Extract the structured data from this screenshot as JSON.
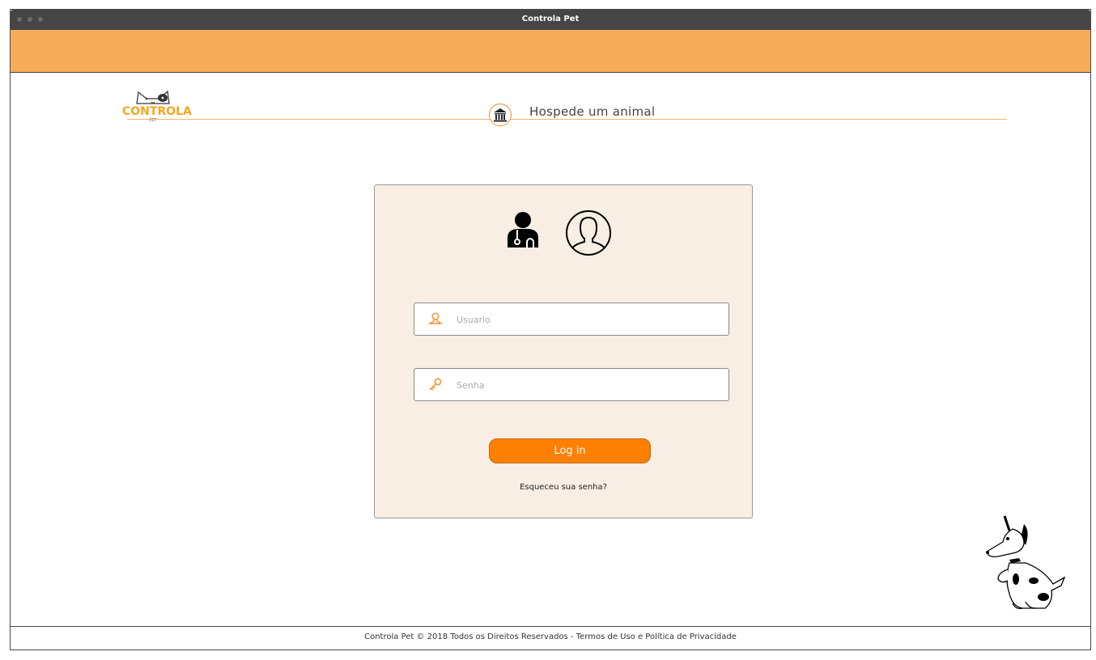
{
  "window": {
    "title": "Controla Pet"
  },
  "header": {
    "logo_text": "CONTROLA",
    "logo_subtext": "PET",
    "nav_label": "Hospede um animal",
    "nav_icon": "bank-icon"
  },
  "login": {
    "role_icons": [
      "veterinarian-icon",
      "user-circle-icon"
    ],
    "username_placeholder": "Usuario",
    "password_placeholder": "Senha",
    "submit_label": "Log in",
    "forgot_link": "Esqueceu sua senha?"
  },
  "footer": {
    "text": "Controla Pet © 2018 Todos os Direitos Reservados - Termos de Uso e Política de Privacidade"
  },
  "colors": {
    "accent": "#ff7f00",
    "header_bar": "#f5ad5a",
    "card_bg": "#f8eee3",
    "logo": "#f5a623"
  }
}
